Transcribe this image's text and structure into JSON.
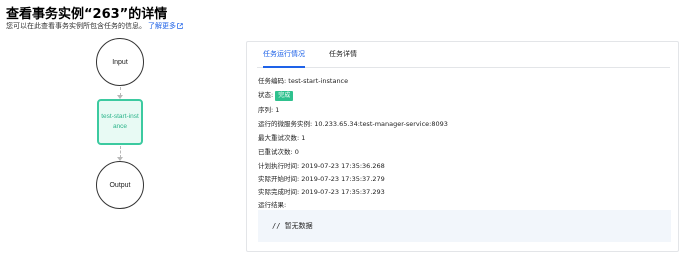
{
  "page": {
    "title": "查看事务实例“263”的详情",
    "description": "您可以在此查看事务实例所包含任务的信息。",
    "learn_more": "了解更多"
  },
  "flow": {
    "input_label": "Input",
    "task_label": "test-start-instance",
    "output_label": "Output",
    "task_status_color": "#3ccaa0"
  },
  "tabs": [
    {
      "label": "任务运行情况",
      "active": true
    },
    {
      "label": "任务详情",
      "active": false
    }
  ],
  "details": {
    "task_code_label": "任务编码:",
    "task_code": "test-start-instance",
    "status_label": "状态:",
    "status": "完成",
    "sequence_label": "序列:",
    "sequence": "1",
    "service_instance_label": "运行的微服务实例:",
    "service_instance": "10.233.65.34:test-manager-service:8093",
    "max_retry_label": "最大重试次数:",
    "max_retry": "1",
    "retried_label": "已重试次数:",
    "retried": "0",
    "planned_time_label": "计划执行时间:",
    "planned_time": "2019-07-23 17:35:36.268",
    "start_time_label": "实际开始时间:",
    "start_time": "2019-07-23 17:35:37.279",
    "end_time_label": "实际完成时间:",
    "end_time": "2019-07-23 17:35:37.293",
    "result_label": "运行结果:",
    "result": "// 暂无数据"
  },
  "colors": {
    "accent": "#1e62e8",
    "success": "#2fc18e"
  }
}
